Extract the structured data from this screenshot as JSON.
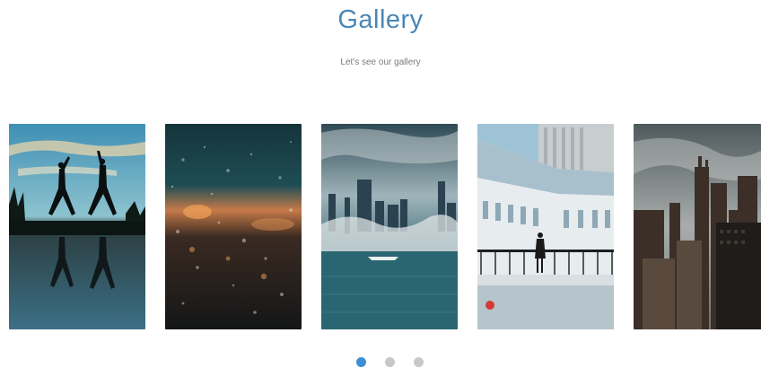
{
  "header": {
    "title": "Gallery",
    "subtitle": "Let's see our gallery"
  },
  "colors": {
    "title": "#4a87b5",
    "dot_active": "#3d8fd4",
    "dot_inactive": "#c8c8c8"
  },
  "carousel": {
    "slides_visible": 5,
    "pages": 3,
    "active_page": 1
  }
}
